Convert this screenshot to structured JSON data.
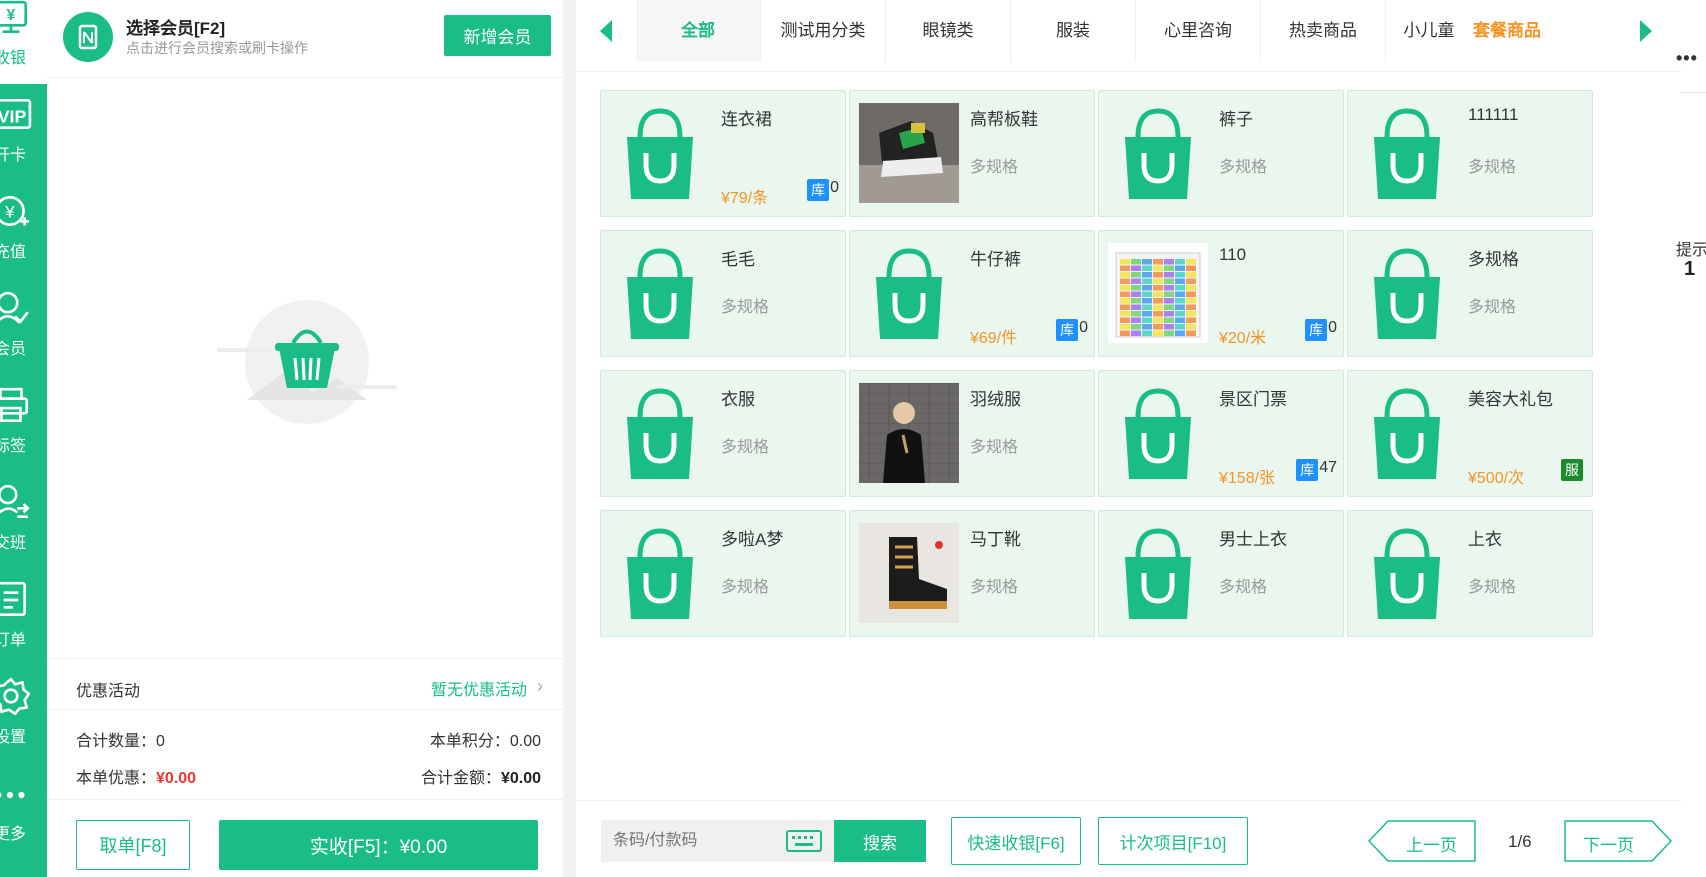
{
  "sidebar": {
    "items": [
      {
        "label": "收银",
        "icon": "cashier-icon",
        "active": true
      },
      {
        "label": "开卡",
        "icon": "vip-card-icon"
      },
      {
        "label": "充值",
        "icon": "recharge-icon"
      },
      {
        "label": "会员",
        "icon": "member-icon"
      },
      {
        "label": "标签",
        "icon": "printer-icon"
      },
      {
        "label": "交班",
        "icon": "shift-icon"
      },
      {
        "label": "订单",
        "icon": "order-icon"
      },
      {
        "label": "设置",
        "icon": "gear-icon"
      },
      {
        "label": "更多",
        "icon": "more-icon"
      }
    ]
  },
  "member": {
    "title": "选择会员[F2]",
    "subtitle": "点击进行会员搜索或刷卡操作",
    "new_button": "新增会员"
  },
  "promo": {
    "label": "优惠活动",
    "value": "暂无优惠活动"
  },
  "totals": {
    "qty_label": "合计数量：",
    "qty_value": "0",
    "points_label": "本单积分：",
    "points_value": "0.00",
    "discount_label": "本单优惠：",
    "discount_value": "¥0.00",
    "amount_label": "合计金额：",
    "amount_value": "¥0.00"
  },
  "actions": {
    "cancel": "取单[F8]",
    "pay": "实收[F5]：¥0.00"
  },
  "tabs": [
    "全部",
    "测试用分类",
    "眼镜类",
    "服装",
    "心里咨询",
    "热卖商品",
    "小儿童",
    "套餐商品"
  ],
  "products": [
    {
      "name": "连衣裙",
      "price": "¥79/条",
      "stock_tag": "库",
      "stock": "0",
      "thumb": "bag"
    },
    {
      "name": "高帮板鞋",
      "spec": "多规格",
      "thumb": "sneaker"
    },
    {
      "name": "裤子",
      "spec": "多规格",
      "thumb": "bag"
    },
    {
      "name": "111111",
      "spec": "多规格",
      "thumb": "bag"
    },
    {
      "name": "毛毛",
      "spec": "多规格",
      "thumb": "bag"
    },
    {
      "name": "牛仔裤",
      "price": "¥69/件",
      "stock_tag": "库",
      "stock": "0",
      "thumb": "bag"
    },
    {
      "name": "110",
      "price": "¥20/米",
      "stock_tag": "库",
      "stock": "0",
      "thumb": "spreadsheet"
    },
    {
      "name": "多规格",
      "spec": "多规格",
      "thumb": "bag"
    },
    {
      "name": "衣服",
      "spec": "多规格",
      "thumb": "bag"
    },
    {
      "name": "羽绒服",
      "spec": "多规格",
      "thumb": "person"
    },
    {
      "name": "景区门票",
      "price": "¥158/张",
      "stock_tag": "库",
      "stock": "47",
      "thumb": "bag"
    },
    {
      "name": "美容大礼包",
      "price": "¥500/次",
      "service_tag": "服",
      "thumb": "bag"
    },
    {
      "name": "多啦A梦",
      "spec": "多规格",
      "thumb": "bag"
    },
    {
      "name": "马丁靴",
      "spec": "多规格",
      "thumb": "boot"
    },
    {
      "name": "男士上衣",
      "spec": "多规格",
      "thumb": "bag"
    },
    {
      "name": "上衣",
      "spec": "多规格",
      "thumb": "bag"
    }
  ],
  "bottom": {
    "search_placeholder": "条码/付款码",
    "search_button": "搜索",
    "quick_cashier": "快速收银[F6]",
    "count_items": "计次项目[F10]",
    "prev": "上一页",
    "page": "1/6",
    "next": "下一页"
  },
  "edge": {
    "more": "•••",
    "tip": "提示",
    "num": "1"
  },
  "colors": {
    "accent": "#19bd85",
    "orange": "#f49523",
    "red": "#f03232",
    "stock_blue": "#1e90ff",
    "service_green": "#1a8a2a"
  }
}
